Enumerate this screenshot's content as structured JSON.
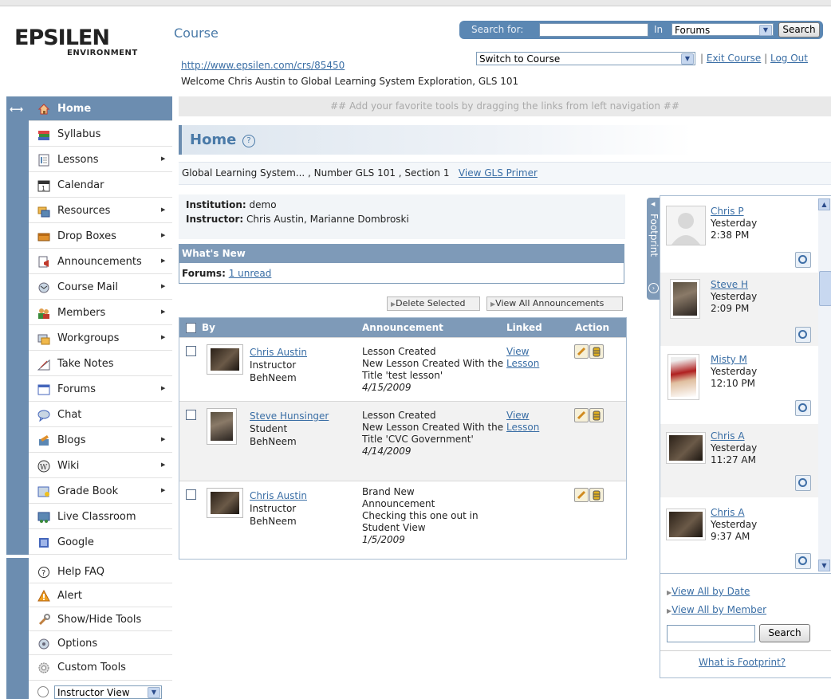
{
  "header": {
    "logo_text": "EPSILEN",
    "logo_sub": "ENVIRONMENT",
    "course_label": "Course",
    "course_url": "http://www.epsilen.com/crs/85450",
    "welcome": "Welcome Chris Austin to Global Learning System Exploration, GLS 101",
    "search_for_label": "Search for:",
    "search_value": "",
    "in_label": "In",
    "search_scope": "Forums",
    "search_button": "Search",
    "switch_course": "Switch to Course",
    "exit_course": "Exit Course",
    "log_out": "Log Out"
  },
  "nav": {
    "items": [
      {
        "label": "Home",
        "icon": "house-icon",
        "arrow": false
      },
      {
        "label": "Syllabus",
        "icon": "books-icon",
        "arrow": false
      },
      {
        "label": "Lessons",
        "icon": "document-icon",
        "arrow": true
      },
      {
        "label": "Calendar",
        "icon": "calendar-icon",
        "arrow": false
      },
      {
        "label": "Resources",
        "icon": "folders-icon",
        "arrow": true
      },
      {
        "label": "Drop Boxes",
        "icon": "dropbox-icon",
        "arrow": true
      },
      {
        "label": "Announcements",
        "icon": "announcement-icon",
        "arrow": true
      },
      {
        "label": "Course Mail",
        "icon": "mail-icon",
        "arrow": true
      },
      {
        "label": "Members",
        "icon": "members-icon",
        "arrow": true
      },
      {
        "label": "Workgroups",
        "icon": "workgroups-icon",
        "arrow": true
      },
      {
        "label": "Take Notes",
        "icon": "notes-icon",
        "arrow": false
      },
      {
        "label": "Forums",
        "icon": "forums-icon",
        "arrow": true
      },
      {
        "label": "Chat",
        "icon": "chat-icon",
        "arrow": false
      },
      {
        "label": "Blogs",
        "icon": "blogs-icon",
        "arrow": true
      },
      {
        "label": "Wiki",
        "icon": "wiki-icon",
        "arrow": true
      },
      {
        "label": "Grade Book",
        "icon": "gradebook-icon",
        "arrow": true
      },
      {
        "label": "Live Classroom",
        "icon": "live-classroom-icon",
        "arrow": false
      },
      {
        "label": "Google",
        "icon": "google-icon",
        "arrow": false
      }
    ],
    "tools": [
      {
        "label": "Help FAQ",
        "icon": "help-icon"
      },
      {
        "label": "Alert",
        "icon": "alert-icon"
      },
      {
        "label": "Show/Hide Tools",
        "icon": "wrench-icon"
      },
      {
        "label": "Options",
        "icon": "options-icon"
      },
      {
        "label": "Custom Tools",
        "icon": "custom-tools-icon"
      }
    ],
    "view_select": "Instructor View"
  },
  "main": {
    "fav_hint": "## Add your favorite tools by dragging the links from left navigation ##",
    "title": "Home",
    "crumb": "Global Learning System... , Number GLS 101 , Section 1",
    "primer_link": "View GLS Primer",
    "institution_label": "Institution:",
    "institution": "demo",
    "instructor_label": "Instructor:",
    "instructor": "Chris Austin, Marianne Dombroski",
    "whats_new": "What's New",
    "forums_label": "Forums:",
    "forums_unread": "1 unread",
    "delete_selected": "Delete Selected",
    "view_all_announcements": "View All Announcements",
    "columns": [
      "By",
      "Announcement",
      "Linked",
      "Action"
    ],
    "announcements": [
      {
        "name": "Chris Austin",
        "role": "Instructor",
        "school": "BehNeem",
        "title": "Lesson Created",
        "body": "New Lesson Created With the Title 'test lesson'",
        "date": "4/15/2009",
        "linked1": "View",
        "linked2": "Lesson"
      },
      {
        "name": "Steve Hunsinger",
        "role": "Student",
        "school": "BehNeem",
        "title": "Lesson Created",
        "body": "New Lesson Created With the Title 'CVC Government'",
        "date": "4/14/2009",
        "linked1": "View",
        "linked2": "Lesson"
      },
      {
        "name": "Chris Austin",
        "role": "Instructor",
        "school": "BehNeem",
        "title": "Brand New Announcement",
        "body": "Checking this one out in Student View",
        "date": "1/5/2009",
        "linked1": "",
        "linked2": ""
      }
    ]
  },
  "footprint": {
    "tab_label": "Footprint",
    "entries": [
      {
        "name": "Chris P",
        "when": "Yesterday",
        "time": "2:38 PM"
      },
      {
        "name": "Steve H",
        "when": "Yesterday",
        "time": "2:09 PM"
      },
      {
        "name": "Misty M",
        "when": "Yesterday",
        "time": "12:10 PM"
      },
      {
        "name": "Chris A",
        "when": "Yesterday",
        "time": "11:27 AM"
      },
      {
        "name": "Chris A",
        "when": "Yesterday",
        "time": "9:37 AM"
      }
    ],
    "view_by_date": "View All by Date",
    "view_by_member": "View All by Member",
    "search_button": "Search",
    "what_is": "What is Footprint?"
  },
  "colors": {
    "accent": "#6c8db0",
    "link": "#3a6ea5",
    "header_bar": "#7e9ab8"
  }
}
